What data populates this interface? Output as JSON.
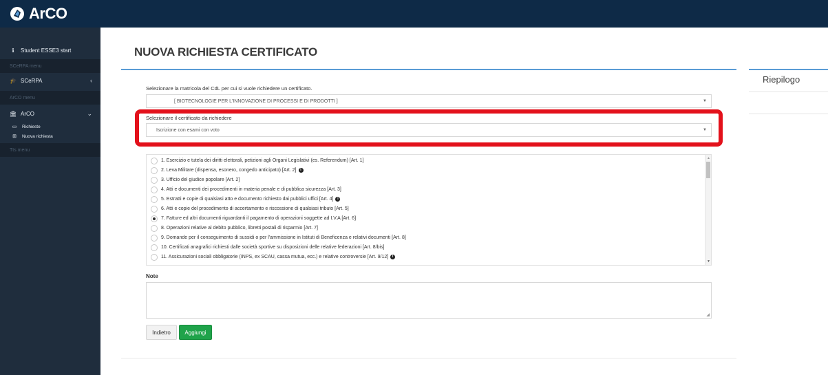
{
  "app": {
    "name": "ArCO"
  },
  "sidebar": {
    "student": "Student ESSE3 start",
    "header_scerpa": "SCeRPA menu",
    "scerpa": "SCeRPA",
    "header_arco": "ArCO menu",
    "arco": "ArCO",
    "sub_richieste": "Richieste",
    "sub_nuova": "Nuova richiesta",
    "header_tts": "Tts menu"
  },
  "main": {
    "title": "NUOVA RICHIESTA CERTIFICATO",
    "matricola_label": "Selezionare la matricola del CdL per cui si vuole richiedere un certificato.",
    "matricola_value": "[ BIOTECNOLOGIE PER L'INNOVAZIONE DI PROCESSI E DI PRODOTTI ]",
    "cert_label": "Selezionare il certificato da richiedere",
    "cert_value": "Iscrizione con esami con voto",
    "options": [
      {
        "text": "1. Esercizio e tutela dei diritti elettorali, petizioni agli Organi Legislativi (es. Referendum) [Art. 1]",
        "info": false,
        "checked": false
      },
      {
        "text": "2. Leva Militare (dispensa, esonero, congedo anticipato) [Art. 2]",
        "info": true,
        "checked": false
      },
      {
        "text": "3. Ufficio del giudice popolare [Art. 2]",
        "info": false,
        "checked": false
      },
      {
        "text": "4. Atti e documenti dei procedimenti in materia penale e di pubblica sicurezza [Art. 3]",
        "info": false,
        "checked": false
      },
      {
        "text": "5. Estratti e copie di qualsiasi atto e documento richiesto dai pubblici uffici [Art. 4]",
        "info": true,
        "checked": false
      },
      {
        "text": "6. Atti e copie del procedimento di accertamento e riscossione di qualsiasi tributo [Art. 5]",
        "info": false,
        "checked": false
      },
      {
        "text": "7. Fatture ed altri documenti riguardanti il pagamento di operazioni soggette ad I.V.A [Art. 6]",
        "info": false,
        "checked": true
      },
      {
        "text": "8. Operazioni relative al debito pubblico, libretti postali di risparmio [Art. 7]",
        "info": false,
        "checked": false
      },
      {
        "text": "9. Domande per il conseguimento di sussidi o per l'ammissione in Istituti di Beneficenza e relativi documenti [Art. 8]",
        "info": false,
        "checked": false
      },
      {
        "text": "10. Certificati anagrafici richiesti dalle società sportive su disposizioni delle relative federazioni [Art. 8/bis]",
        "info": false,
        "checked": false
      },
      {
        "text": "11. Assicurazioni sociali obbligatorie (INPS, ex SCAU, cassa mutua, ecc.) e relative controversie [Art. 9/12]",
        "info": true,
        "checked": false
      }
    ],
    "note_label": "Note",
    "btn_back": "Indietro",
    "btn_add": "Aggiungi"
  },
  "summary": {
    "title": "Riepilogo"
  }
}
